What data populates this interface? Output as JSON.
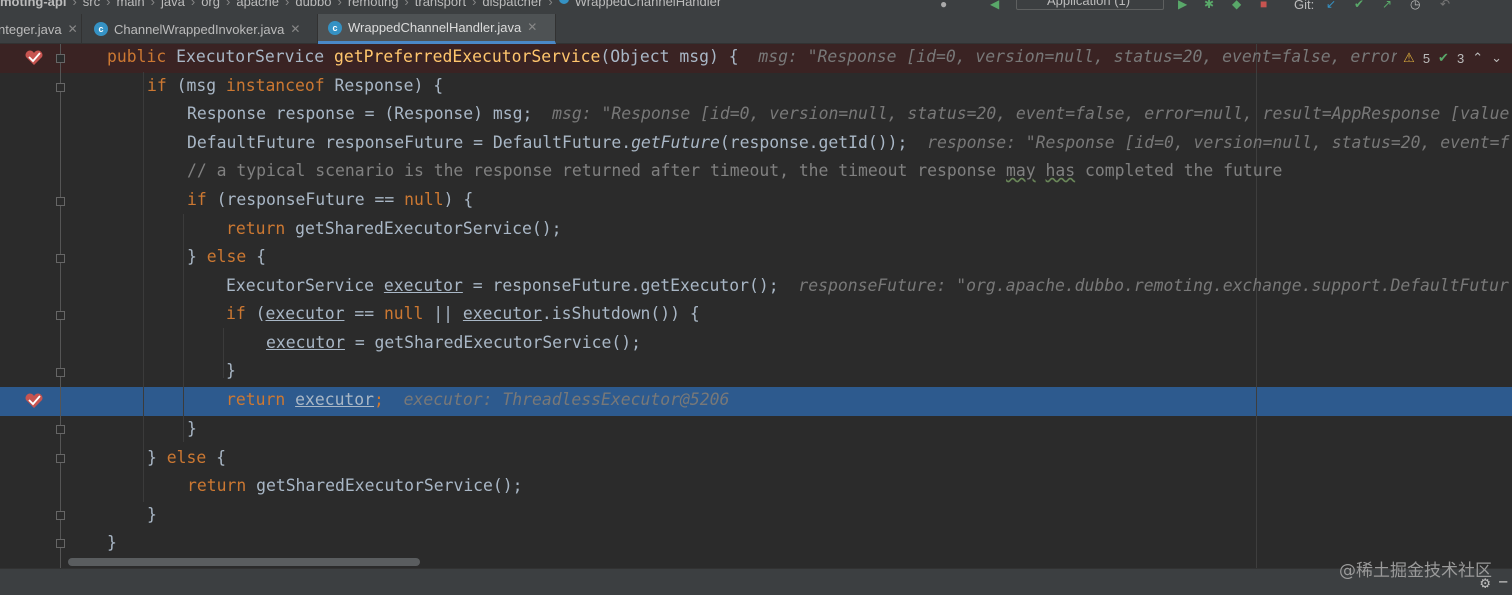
{
  "breadcrumb": [
    "moting-api",
    "src",
    "main",
    "java",
    "org",
    "apache",
    "dubbo",
    "remoting",
    "transport",
    "dispatcher",
    "WrappedChannelHandler"
  ],
  "toolbar": {
    "run_config": "Application (1)",
    "git_label": "Git:"
  },
  "tabs": [
    {
      "label": "nteger.java",
      "active": false
    },
    {
      "label": "ChannelWrappedInvoker.java",
      "active": false
    },
    {
      "label": "WrappedChannelHandler.java",
      "active": true
    }
  ],
  "inspections": {
    "warnings": "5",
    "ok": "3"
  },
  "code": {
    "l1": {
      "mod": "public",
      "type": " ExecutorService ",
      "name": "getPreferredExecutorService",
      "params": "(Object msg) {",
      "hint": "msg: \"Response [id=0, version=null, status=20, event=false, error"
    },
    "l2": {
      "kw": "if",
      "a": " (msg ",
      "kw2": "instanceof",
      "b": " Response) {"
    },
    "l3": {
      "text": "Response response = (Response) msg;",
      "hint": "msg: \"Response [id=0, version=null, status=20, event=false, error=null, result=AppResponse [value"
    },
    "l4": {
      "a": "DefaultFuture responseFuture = DefaultFuture.",
      "it": "getFuture",
      "b": "(response.getId());",
      "hint": "response: \"Response [id=0, version=null, status=20, event=f"
    },
    "l5": {
      "a": "// a typical scenario is the response returned after timeout, the timeout response ",
      "w1": "may",
      "sp": " ",
      "w2": "has",
      "b": " completed the future"
    },
    "l6": {
      "kw": "if",
      "a": " (responseFuture == ",
      "kw2": "null",
      "b": ") {"
    },
    "l7": {
      "kw": "return",
      "a": " getSharedExecutorService();"
    },
    "l8": {
      "a": "} ",
      "kw": "else",
      "b": " {"
    },
    "l9": {
      "a": "ExecutorService ",
      "u": "executor",
      "b": " = responseFuture.getExecutor();",
      "hint": "responseFuture: \"org.apache.dubbo.remoting.exchange.support.DefaultFutur"
    },
    "l10": {
      "kw": "if",
      "a": " (",
      "u1": "executor",
      "b": " == ",
      "kw2": "null",
      "c": " || ",
      "u2": "executor",
      "d": ".isShutdown()) {"
    },
    "l11": {
      "u": "executor",
      "a": " = getSharedExecutorService();"
    },
    "l12": {
      "a": "}"
    },
    "l13": {
      "kw": "return",
      "sp": " ",
      "u": "executor",
      "a": ";",
      "hint": "executor: ThreadlessExecutor@5206"
    },
    "l14": {
      "a": "}"
    },
    "l15": {
      "a": "} ",
      "kw": "else",
      "b": " {"
    },
    "l16": {
      "kw": "return",
      "a": " getSharedExecutorService();"
    },
    "l17": {
      "a": "}"
    },
    "l18": {
      "a": "}"
    }
  },
  "watermark": "@稀土掘金技术社区",
  "icons": [
    "breakpoint-icon",
    "class-icon",
    "close-icon",
    "warning-icon",
    "check-icon",
    "settings-icon"
  ]
}
